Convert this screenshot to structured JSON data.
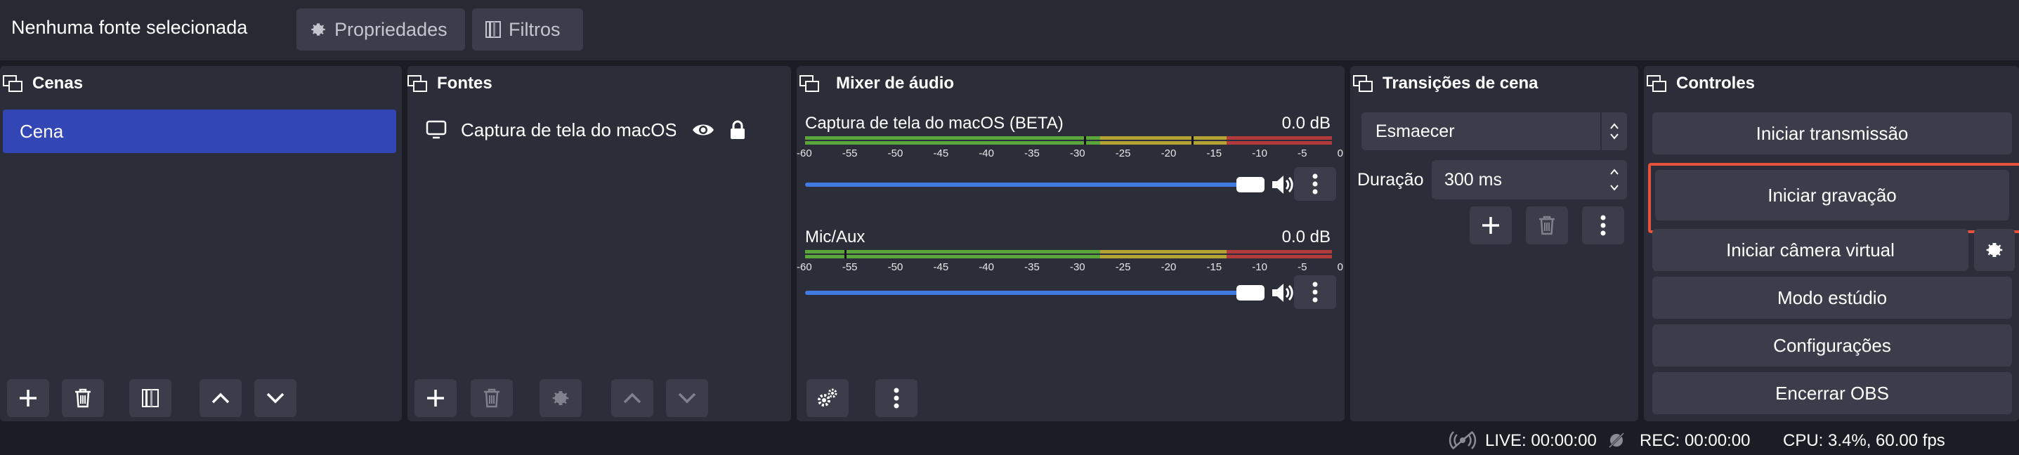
{
  "topbar": {
    "source_label": "Nenhuma fonte selecionada",
    "properties_label": "Propriedades",
    "filters_label": "Filtros"
  },
  "scenes": {
    "title": "Cenas",
    "items": [
      "Cena"
    ]
  },
  "sources": {
    "title": "Fontes",
    "items": [
      {
        "label": "Captura de tela do macOS (",
        "visible": true,
        "locked": true
      }
    ]
  },
  "mixer": {
    "title": "Mixer de áudio",
    "channels": [
      {
        "name": "Captura de tela do macOS (BETA)",
        "db": "0.0 dB",
        "volume": 1.0
      },
      {
        "name": "Mic/Aux",
        "db": "0.0 dB",
        "volume": 1.0
      }
    ],
    "ticks": [
      "-60",
      "-55",
      "-50",
      "-45",
      "-40",
      "-35",
      "-30",
      "-25",
      "-20",
      "-15",
      "-10",
      "-5",
      "0"
    ]
  },
  "transitions": {
    "title": "Transições de cena",
    "selected": "Esmaecer",
    "duration_label": "Duração",
    "duration_value": "300 ms"
  },
  "controls": {
    "title": "Controles",
    "buttons": {
      "start_stream": "Iniciar transmissão",
      "start_record": "Iniciar gravação",
      "start_virtualcam": "Iniciar câmera virtual",
      "studio_mode": "Modo estúdio",
      "settings": "Configurações",
      "exit": "Encerrar OBS"
    },
    "highlight_color": "#e5533c"
  },
  "status": {
    "live": "LIVE: 00:00:00",
    "rec": "REC: 00:00:00",
    "cpu": "CPU: 3.4%, 60.00 fps"
  },
  "colors": {
    "selected_scene": "#3346b5",
    "volume_bar": "#3f7be0",
    "meter_green": "#5aa63a",
    "meter_yellow": "#b3a335",
    "meter_red": "#b23a3a"
  }
}
